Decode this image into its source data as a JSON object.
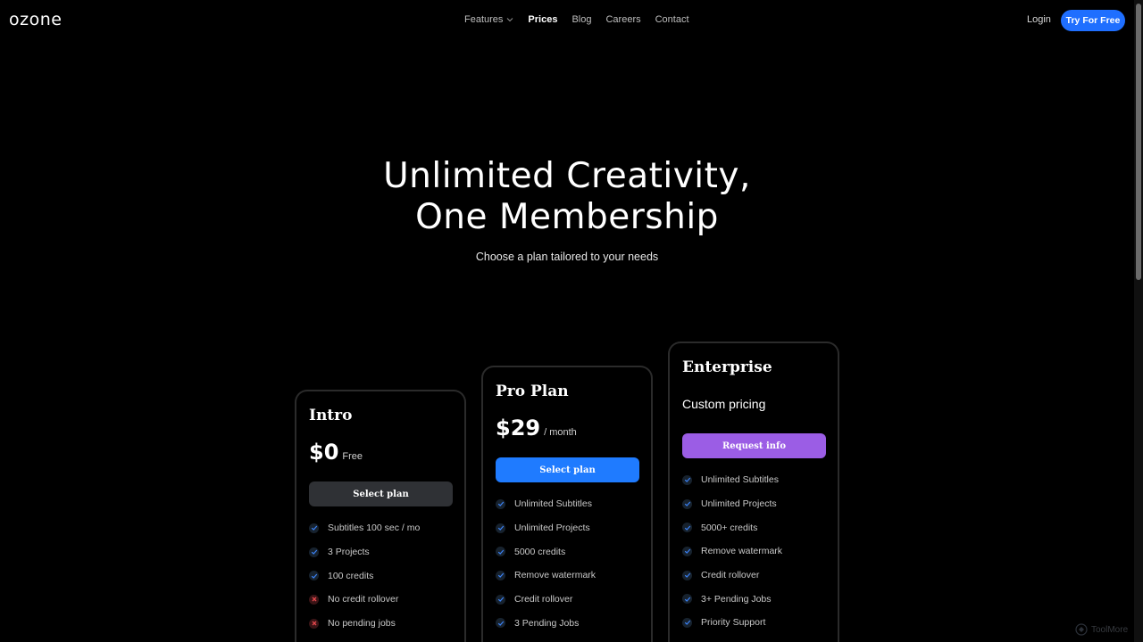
{
  "header": {
    "logo": "ozone",
    "nav": [
      {
        "label": "Features",
        "has_dropdown": true,
        "active": false
      },
      {
        "label": "Prices",
        "active": true
      },
      {
        "label": "Blog",
        "active": false
      },
      {
        "label": "Careers",
        "active": false
      },
      {
        "label": "Contact",
        "active": false
      }
    ],
    "login_label": "Login",
    "cta_label": "Try For Free"
  },
  "hero": {
    "title_line1": "Unlimited Creativity,",
    "title_line2": "One Membership",
    "subtitle": "Choose a plan tailored to your needs"
  },
  "plans": [
    {
      "name": "Intro",
      "price": "$0",
      "price_unit": "Free",
      "button_label": "Select plan",
      "button_color": "#2f3135",
      "features": [
        {
          "text": "Subtitles 100 sec / mo",
          "included": true
        },
        {
          "text": "3 Projects",
          "included": true
        },
        {
          "text": "100 credits",
          "included": true
        },
        {
          "text": "No credit rollover",
          "included": false
        },
        {
          "text": "No pending jobs",
          "included": false
        }
      ]
    },
    {
      "name": "Pro Plan",
      "price": "$29",
      "price_unit": "/ month",
      "button_label": "Select plan",
      "button_color": "#1f7bff",
      "features": [
        {
          "text": "Unlimited Subtitles",
          "included": true
        },
        {
          "text": "Unlimited Projects",
          "included": true
        },
        {
          "text": "5000 credits",
          "included": true
        },
        {
          "text": "Remove watermark",
          "included": true
        },
        {
          "text": "Credit rollover",
          "included": true
        },
        {
          "text": "3 Pending Jobs",
          "included": true
        }
      ]
    },
    {
      "name": "Enterprise",
      "custom_price": "Custom pricing",
      "button_label": "Request info",
      "button_color": "#9b5de5",
      "features": [
        {
          "text": "Unlimited Subtitles",
          "included": true
        },
        {
          "text": "Unlimited Projects",
          "included": true
        },
        {
          "text": "5000+ credits",
          "included": true
        },
        {
          "text": "Remove watermark",
          "included": true
        },
        {
          "text": "Credit rollover",
          "included": true
        },
        {
          "text": "3+ Pending Jobs",
          "included": true
        },
        {
          "text": "Priority Support",
          "included": true
        }
      ]
    }
  ],
  "watermark": "ToolMore",
  "colors": {
    "accent": "#1f6fff",
    "check": "#3b82f6",
    "cross": "#e5484d"
  }
}
